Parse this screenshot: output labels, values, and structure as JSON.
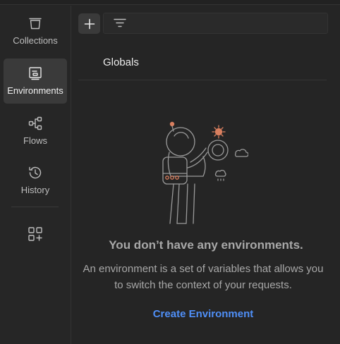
{
  "sidebar": {
    "items": [
      {
        "label": "Collections",
        "icon": "collections-icon"
      },
      {
        "label": "Environments",
        "icon": "environments-icon",
        "active": true
      },
      {
        "label": "Flows",
        "icon": "flows-icon"
      },
      {
        "label": "History",
        "icon": "history-icon"
      }
    ],
    "extra_icon": "add-widget-icon"
  },
  "toolbar": {
    "add_icon": "plus-icon",
    "filter_icon": "filter-icon"
  },
  "list": {
    "globals_label": "Globals"
  },
  "empty_state": {
    "illustration": "astronaut-illustration",
    "title": "You don’t have any environments.",
    "description": "An environment is a set of variables that allows you to switch the context of your requests.",
    "action_label": "Create Environment"
  },
  "colors": {
    "background": "#252525",
    "active_item": "#3a3a3a",
    "link": "#4f8ff7",
    "muted_text": "#a8a8a8"
  }
}
